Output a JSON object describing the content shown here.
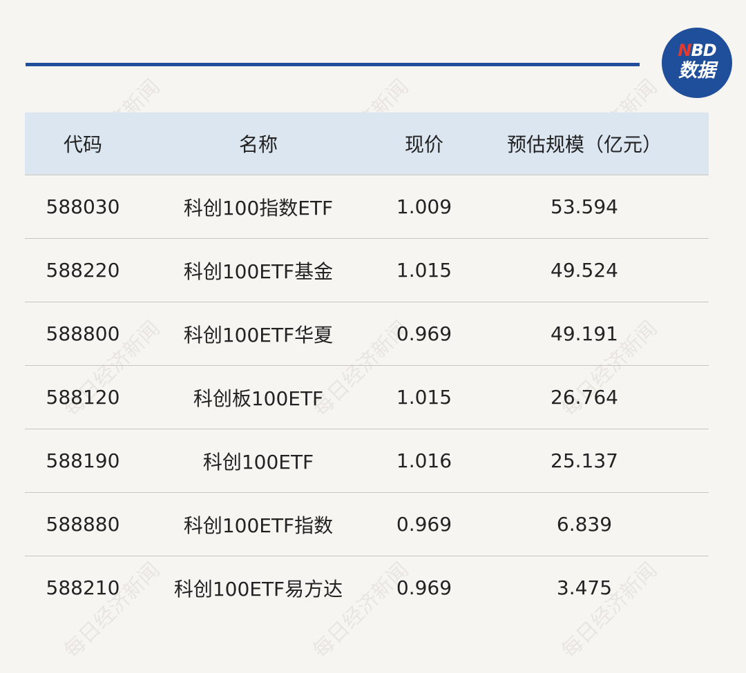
{
  "logo": {
    "line1_n": "N",
    "line1_rest": "BD",
    "line2": "数据"
  },
  "watermark": "每日经济新闻",
  "table": {
    "headers": [
      "代码",
      "名称",
      "现价",
      "预估规模（亿元）"
    ],
    "rows": [
      [
        "588030",
        "科创100指数ETF",
        "1.009",
        "53.594"
      ],
      [
        "588220",
        "科创100ETF基金",
        "1.015",
        "49.524"
      ],
      [
        "588800",
        "科创100ETF华夏",
        "0.969",
        "49.191"
      ],
      [
        "588120",
        "科创板100ETF",
        "1.015",
        "26.764"
      ],
      [
        "588190",
        "科创100ETF",
        "1.016",
        "25.137"
      ],
      [
        "588880",
        "科创100ETF指数",
        "0.969",
        "6.839"
      ],
      [
        "588210",
        "科创100ETF易方达",
        "0.969",
        "3.475"
      ]
    ]
  },
  "colors": {
    "accent": "#1f4e9a",
    "header_bg": "#dbe6f0",
    "page_bg": "#f7f5f2",
    "logo_n": "#e8392e"
  }
}
